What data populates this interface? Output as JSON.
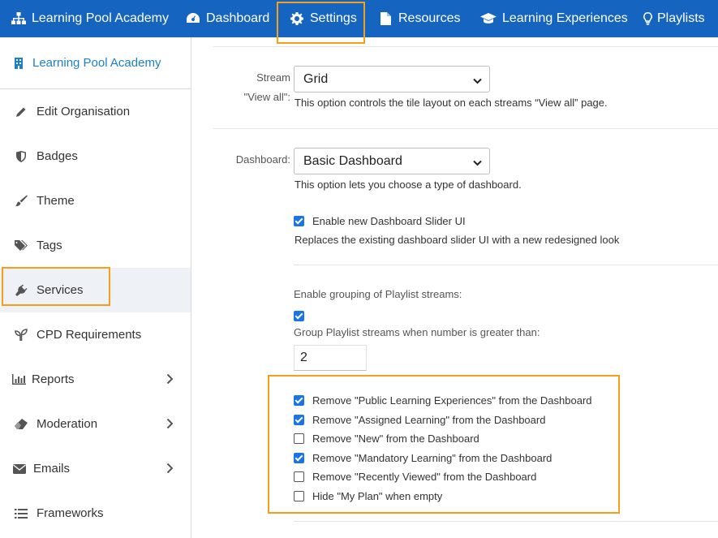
{
  "topnav": {
    "items": [
      {
        "label": "Learning Pool Academy",
        "icon": "sitemap-icon"
      },
      {
        "label": "Dashboard",
        "icon": "dashboard-gauge-icon"
      },
      {
        "label": "Settings",
        "icon": "gear-icon"
      },
      {
        "label": "Resources",
        "icon": "file-icon"
      },
      {
        "label": "Learning Experiences",
        "icon": "graduation-cap-icon"
      },
      {
        "label": "Playlists",
        "icon": "lightbulb-icon"
      }
    ],
    "active": "Settings",
    "color": "#1565c0"
  },
  "sidebar": {
    "header": "Learning Pool Academy",
    "items": [
      {
        "label": "Edit Organisation",
        "icon": "pencil-icon"
      },
      {
        "label": "Badges",
        "icon": "shield-icon"
      },
      {
        "label": "Theme",
        "icon": "paintbrush-icon"
      },
      {
        "label": "Tags",
        "icon": "tags-icon"
      },
      {
        "label": "Services",
        "icon": "plug-icon"
      },
      {
        "label": "CPD Requirements",
        "icon": "seedling-icon"
      },
      {
        "label": "Reports",
        "icon": "bar-chart-icon"
      },
      {
        "label": "Moderation",
        "icon": "eraser-icon"
      },
      {
        "label": "Emails",
        "icon": "envelope-icon"
      },
      {
        "label": "Frameworks",
        "icon": "list-icon"
      }
    ],
    "active": "Services"
  },
  "settings": {
    "stream": {
      "label_line1": "Stream",
      "label_line2": "\"View all\":",
      "value": "Grid",
      "help": "This option controls the tile layout on each streams “View all” page."
    },
    "dashboard": {
      "label": "Dashboard:",
      "value": "Basic Dashboard",
      "help": "This option lets you choose a type of dashboard.",
      "slider_label": "Enable new Dashboard Slider UI",
      "slider_checked": true,
      "slider_help": "Replaces the existing dashboard slider UI with a new redesigned look"
    },
    "grouping": {
      "title": "Enable grouping of Playlist streams:",
      "checked": true,
      "threshold_label": "Group Playlist streams when number is greater than:",
      "threshold_value": "2"
    },
    "remove_options": [
      {
        "label": "Remove \"Public Learning Experiences\" from the Dashboard",
        "checked": true
      },
      {
        "label": "Remove \"Assigned Learning\" from the Dashboard",
        "checked": true
      },
      {
        "label": "Remove \"New\" from the Dashboard",
        "checked": false
      },
      {
        "label": "Remove \"Mandatory Learning\" from the Dashboard",
        "checked": true
      },
      {
        "label": "Remove \"Recently Viewed\" from the Dashboard",
        "checked": false
      },
      {
        "label": "Hide \"My Plan\" when empty",
        "checked": false
      }
    ]
  }
}
